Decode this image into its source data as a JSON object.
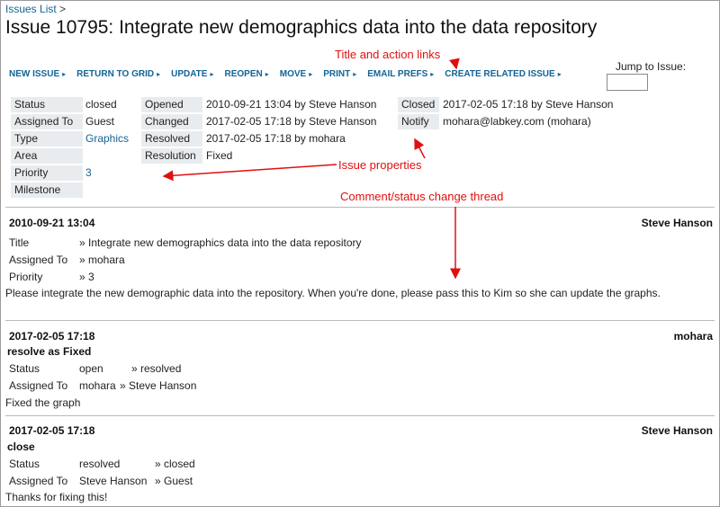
{
  "breadcrumb": {
    "link": "Issues List",
    "sep": ">"
  },
  "title": "Issue 10795: Integrate new demographics data into the data repository",
  "annotations": {
    "title_links": "Title and action links",
    "issue_properties": "Issue properties",
    "comment_thread": "Comment/status change thread"
  },
  "toolbar": {
    "items": [
      "NEW ISSUE",
      "RETURN TO GRID",
      "UPDATE",
      "REOPEN",
      "MOVE",
      "PRINT",
      "EMAIL PREFS",
      "CREATE RELATED ISSUE"
    ],
    "arrow": "▸"
  },
  "jump": {
    "label": "Jump to Issue:",
    "value": ""
  },
  "properties": {
    "status": {
      "label": "Status",
      "value": "closed"
    },
    "assigned_to": {
      "label": "Assigned To",
      "value": "Guest"
    },
    "type": {
      "label": "Type",
      "value": "Graphics"
    },
    "area": {
      "label": "Area",
      "value": ""
    },
    "priority": {
      "label": "Priority",
      "value": "3"
    },
    "milestone": {
      "label": "Milestone",
      "value": ""
    },
    "opened": {
      "label": "Opened",
      "value": "2010-09-21 13:04 by Steve Hanson"
    },
    "changed": {
      "label": "Changed",
      "value": "2017-02-05 17:18 by Steve Hanson"
    },
    "resolved": {
      "label": "Resolved",
      "value": "2017-02-05 17:18 by mohara"
    },
    "resolution": {
      "label": "Resolution",
      "value": "Fixed"
    },
    "closed": {
      "label": "Closed",
      "value": "2017-02-05 17:18 by Steve Hanson"
    },
    "notify": {
      "label": "Notify",
      "value": "mohara@labkey.com (mohara)"
    }
  },
  "comments": [
    {
      "date": "2010-09-21 13:04",
      "author": "Steve Hanson",
      "fields": [
        {
          "label": "Title",
          "value": "» Integrate new demographics data into the data repository"
        },
        {
          "label": "Assigned To",
          "value": "» mohara"
        },
        {
          "label": "Priority",
          "value": "» 3"
        }
      ],
      "message": "Please integrate the new demographic data into the repository. When you're done, please pass this to Kim so she can update the graphs."
    },
    {
      "date": "2017-02-05 17:18",
      "author": "mohara",
      "action": "resolve as Fixed",
      "fields": [
        {
          "label": "Status",
          "old": "open",
          "new": "» resolved"
        },
        {
          "label": "Assigned To",
          "old": "mohara",
          "new": "» Steve Hanson"
        }
      ],
      "message": "Fixed the graph"
    },
    {
      "date": "2017-02-05 17:18",
      "author": "Steve Hanson",
      "action": "close",
      "fields": [
        {
          "label": "Status",
          "old": "resolved",
          "new": "» closed"
        },
        {
          "label": "Assigned To",
          "old": "Steve Hanson",
          "new": "» Guest"
        }
      ],
      "message": "Thanks for fixing this!"
    }
  ],
  "colors": {
    "link": "#126495",
    "annotation": "#e01010",
    "label_bg": "#e8ecef"
  }
}
